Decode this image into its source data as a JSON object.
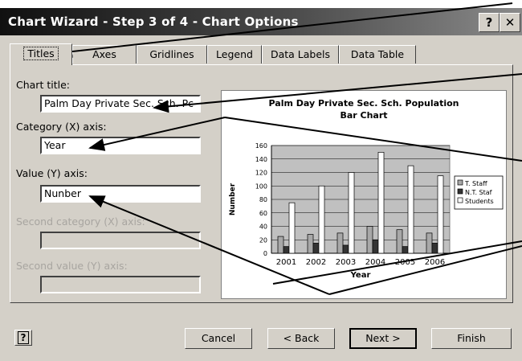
{
  "window": {
    "title": "Chart Wizard - Step 3 of 4 - Chart Options",
    "help_glyph": "?",
    "close_glyph": "✕"
  },
  "tabs": [
    {
      "label": "Titles"
    },
    {
      "label": "Axes"
    },
    {
      "label": "Gridlines"
    },
    {
      "label": "Legend"
    },
    {
      "label": "Data Labels"
    },
    {
      "label": "Data Table"
    }
  ],
  "form": {
    "chart_title_label": "Chart title:",
    "chart_title_value": "Palm Day Private Sec. Sch. Pc",
    "category_label": "Category (X) axis:",
    "category_value": "Year",
    "value_label": "Value (Y) axis:",
    "value_value": "Nunber",
    "second_category_label": "Second category (X) axis:",
    "second_value_label": "Second value (Y) axis:"
  },
  "buttons": {
    "help": "?",
    "cancel": "Cancel",
    "back": "< Back",
    "next": "Next >",
    "finish": "Finish"
  },
  "chart_data": {
    "type": "bar",
    "title": "Palm Day Private Sec. Sch. Population",
    "subtitle": "Bar Chart",
    "xlabel": "Year",
    "ylabel": "Number",
    "categories": [
      "2001",
      "2002",
      "2003",
      "2004",
      "2005",
      "2006"
    ],
    "ylim": [
      0,
      160
    ],
    "yticks": [
      "0",
      "20",
      "40",
      "60",
      "80",
      "100",
      "120",
      "140",
      "160"
    ],
    "grid": true,
    "legend_position": "right",
    "series": [
      {
        "name": "T. Staff",
        "color": "#a8a8a8",
        "values": [
          25,
          28,
          30,
          40,
          35,
          30
        ]
      },
      {
        "name": "N.T. Staf",
        "color": "#333333",
        "values": [
          10,
          15,
          12,
          20,
          10,
          15
        ]
      },
      {
        "name": "Students",
        "color": "#ffffff",
        "values": [
          75,
          100,
          120,
          150,
          130,
          115
        ]
      }
    ]
  }
}
